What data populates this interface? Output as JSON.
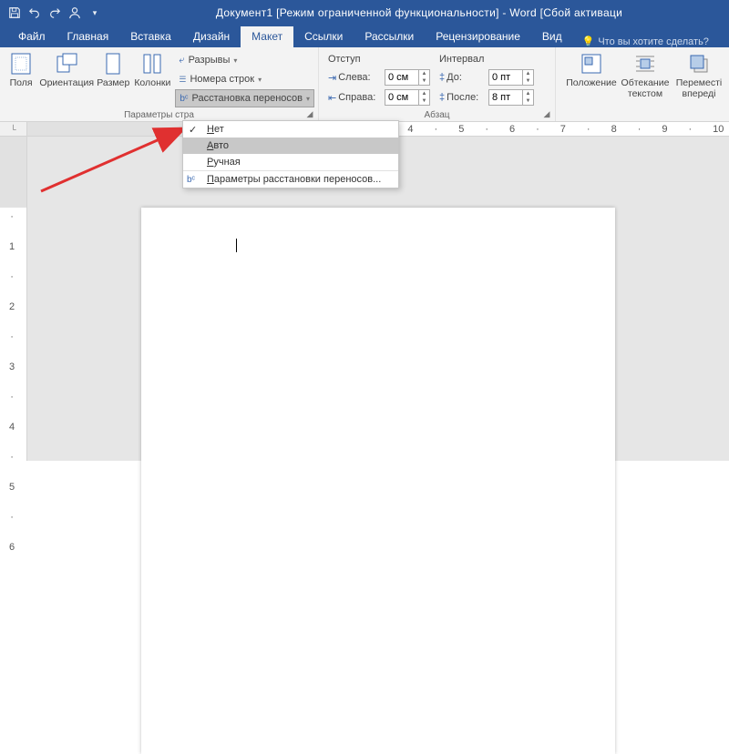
{
  "title": "Документ1 [Режим ограниченной функциональности] - Word [Сбой активаци",
  "tabs": {
    "file": "Файл",
    "home": "Главная",
    "insert": "Вставка",
    "design": "Дизайн",
    "layout": "Макет",
    "references": "Ссылки",
    "mailings": "Рассылки",
    "review": "Рецензирование",
    "view": "Вид",
    "tellme": "Что вы хотите сделать?"
  },
  "ribbon": {
    "pageSetup": {
      "margins": "Поля",
      "orientation": "Ориентация",
      "size": "Размер",
      "columns": "Колонки",
      "breaks": "Разрывы",
      "lineNumbers": "Номера строк",
      "hyphenation": "Расстановка переносов",
      "groupLabel": "Параметры стра"
    },
    "paragraph": {
      "indentHead": "Отступ",
      "spacingHead": "Интервал",
      "left": "Слева:",
      "right": "Справа:",
      "before": "До:",
      "after": "После:",
      "leftVal": "0 см",
      "rightVal": "0 см",
      "beforeVal": "0 пт",
      "afterVal": "8 пт",
      "groupLabel": "Абзац"
    },
    "arrange": {
      "position": "Положение",
      "wrap": "Обтекание текстом",
      "forward": "Переместі впереді"
    }
  },
  "dropdown": {
    "none": "Нет",
    "auto": "Авто",
    "manual": "Ручная",
    "options": "Параметры расстановки переносов..."
  }
}
